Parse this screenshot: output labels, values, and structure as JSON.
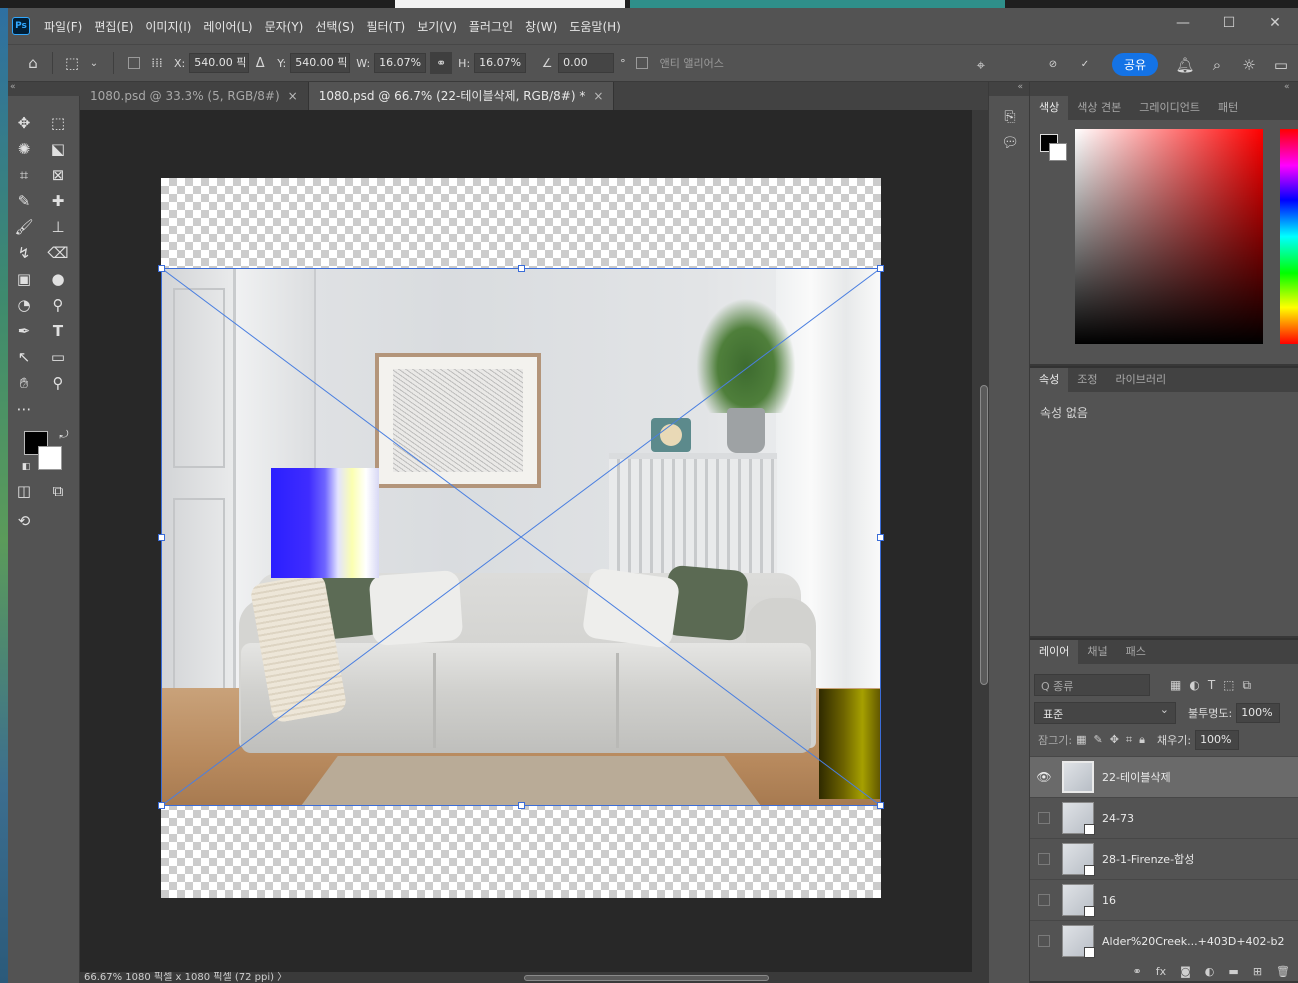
{
  "menu": [
    "파일(F)",
    "편집(E)",
    "이미지(I)",
    "레이어(L)",
    "문자(Y)",
    "선택(S)",
    "필터(T)",
    "보기(V)",
    "플러그인",
    "창(W)",
    "도움말(H)"
  ],
  "window_controls": [
    "—",
    "☐",
    "✕"
  ],
  "options": {
    "x_label": "X:",
    "x_value": "540.00 픽",
    "y_label": "Y:",
    "y_value": "540.00 픽",
    "w_label": "W:",
    "w_value": "16.07%",
    "h_label": "H:",
    "h_value": "16.07%",
    "angle_value": "0.00",
    "degree": "°",
    "antialias": "앤티 앨리어스",
    "share": "공유"
  },
  "doc_tabs": [
    {
      "label": "1080.psd @ 33.3% (5, RGB/8#)",
      "close": "×"
    },
    {
      "label": "1080.psd @ 66.7% (22-테이블삭제, RGB/8#) *",
      "close": "×"
    }
  ],
  "status": {
    "text": "66.67%   1080 픽셀 x 1080 픽셀 (72 ppi)   〉"
  },
  "color_panel": {
    "tabs": [
      "색상",
      "색상 견본",
      "그레이디언트",
      "패턴"
    ]
  },
  "props_panel": {
    "tabs": [
      "속성",
      "조정",
      "라이브러리"
    ],
    "empty": "속성 없음"
  },
  "layers_panel": {
    "tabs": [
      "레이어",
      "채널",
      "패스"
    ],
    "search": "Q 종류",
    "blend_mode": "표준",
    "opacity_label": "불투명도:",
    "opacity": "100%",
    "lock_label": "잠그기:",
    "fill_label": "채우기:",
    "fill": "100%",
    "layers": [
      {
        "name": "22-테이블삭제",
        "visible": true,
        "selected": true
      },
      {
        "name": "24-73",
        "visible": false,
        "selected": false
      },
      {
        "name": "28-1-Firenze-합성",
        "visible": false,
        "selected": false
      },
      {
        "name": "16",
        "visible": false,
        "selected": false
      },
      {
        "name": "Alder%20Creek...+403D+402-b2",
        "visible": false,
        "selected": false
      }
    ]
  },
  "colors": {
    "accent": "#1473e6",
    "panel": "#535353",
    "canvas_bg": "#282828",
    "transform": "#3b6dd8"
  }
}
